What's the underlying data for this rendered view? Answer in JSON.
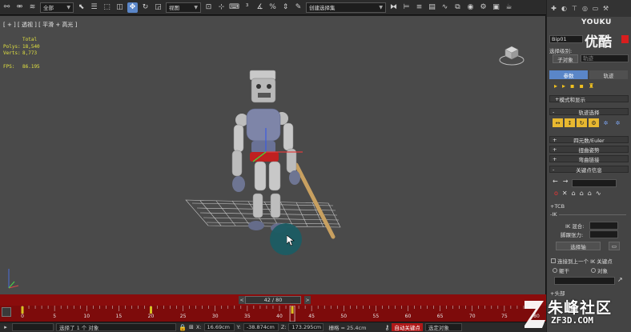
{
  "toolbar": {
    "selection_filter": "全部",
    "ref_coord": "视图",
    "named_selection": "创建选择集"
  },
  "viewport": {
    "label": "[ + ] [ 透视 ] [ 平滑 + 高光 ]",
    "stats": [
      {
        "key": "",
        "value": "Total"
      },
      {
        "key": "Polys:",
        "value": "18,540"
      },
      {
        "key": "Verts:",
        "value": "8,773"
      },
      {
        "key": "FPS:",
        "value": "86.195"
      }
    ]
  },
  "timeline": {
    "frame_display": "42 / 80",
    "prev_label": "<",
    "next_label": ">",
    "ticks": [
      "0",
      "5",
      "10",
      "15",
      "20",
      "25",
      "30",
      "35",
      "40",
      "45",
      "50",
      "55",
      "60",
      "65",
      "70",
      "75",
      "80"
    ],
    "current_frame": 42,
    "total_frames": 80
  },
  "statusbar": {
    "selection": "选择了 1 个 对象",
    "x_label": "X:",
    "x_value": "16.69cm",
    "y_label": "Y:",
    "y_value": "-38.874cm",
    "z_label": "Z:",
    "z_value": "173.295cm",
    "grid": "栅格 = 25.4cm",
    "auto_key": "自动关键点",
    "selected_filter": "选定对象"
  },
  "panel": {
    "object_name": "Bip01",
    "selection_level_label": "选择级别:",
    "sub_object_label": "子对象",
    "track_dropdown": "轨迹",
    "tab_params": "参数",
    "tab_tracks": "轨迹",
    "rollouts": {
      "mode_display": "模式和显示",
      "track_selection": "轨迹选择",
      "quaternion": "四元数/Euler",
      "twist": "扭曲姿势",
      "bend": "弯曲链接",
      "key_info": "关键点信息"
    },
    "tcb": "TCB",
    "ik": "IK",
    "ik_blend": "IK 混合:",
    "ankle_tension": "脚踝张力:",
    "pivot": "选择轴",
    "join_prev": "连接到上一个 IK 关键点",
    "body": "躯干",
    "object": "对象",
    "head": "头部"
  },
  "watermarks": {
    "youku": "YOUKU",
    "youku_cn": "优酷",
    "site_cn": "朱峰社区",
    "site_url": "ZF3D.COM"
  },
  "colors": {
    "timeline_red": "#8a0c0c",
    "active_blue": "#5a86c8",
    "stats_yellow": "#e0e040",
    "cursor_teal": "#1b5c63"
  }
}
